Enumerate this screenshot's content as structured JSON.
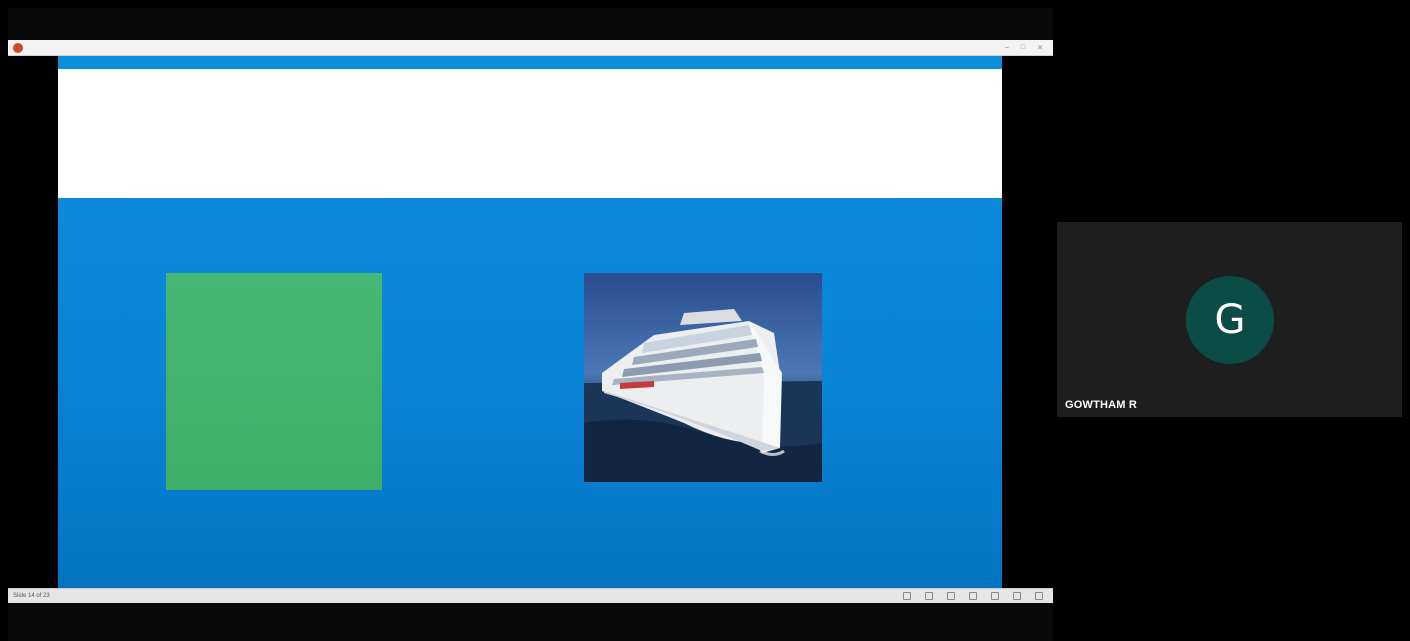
{
  "window": {
    "title": "",
    "controls": [
      "–",
      "□",
      "✕"
    ]
  },
  "status_bar": {
    "slide_counter": "Slide 14 of 23"
  },
  "participant": {
    "avatar_initial": "G",
    "name": "GOWTHAM R"
  },
  "colors": {
    "slide_background": "#0a84d6",
    "green_box": "#46b774",
    "avatar_background": "#0b4d44",
    "tile_background": "#1e1e1e"
  }
}
